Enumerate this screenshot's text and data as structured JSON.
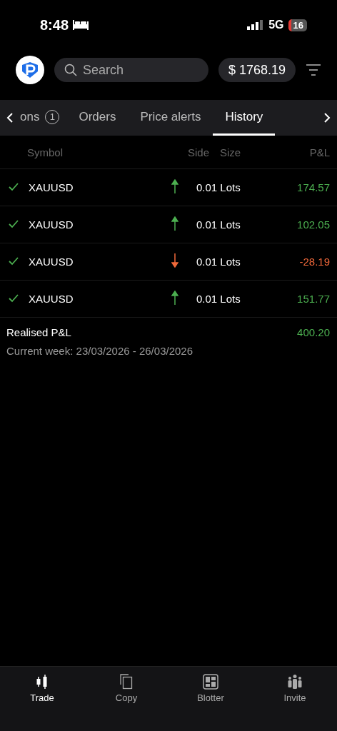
{
  "status_bar": {
    "time": "8:48",
    "network": "5G",
    "battery": "16"
  },
  "header": {
    "search": {
      "placeholder": "Search"
    },
    "balance": "$ 1768.19"
  },
  "tabs": [
    {
      "label": "ons",
      "count": "1",
      "selected": false
    },
    {
      "label": "Orders",
      "selected": false
    },
    {
      "label": "Price alerts",
      "selected": false
    },
    {
      "label": "History",
      "selected": true
    }
  ],
  "table": {
    "columns": [
      "Symbol",
      "Side",
      "Size",
      "P&L"
    ],
    "rows": [
      {
        "checked": true,
        "symbol": "XAUUSD",
        "kind": "buy",
        "size": "0.01 Lots",
        "pnl": "174.57",
        "color": "#4caf50"
      },
      {
        "checked": true,
        "symbol": "XAUUSD",
        "kind": "buy",
        "size": "0.01 Lots",
        "pnl": "102.05",
        "color": "#4caf50"
      },
      {
        "checked": true,
        "symbol": "XAUUSD",
        "kind": "sell",
        "size": "0.01 Lots",
        "pnl": "-28.19",
        "color": "#f0683a"
      },
      {
        "checked": true,
        "symbol": "XAUUSD",
        "kind": "buy",
        "size": "0.01 Lots",
        "pnl": "151.77",
        "color": "#4caf50"
      }
    ]
  },
  "summary": {
    "label": "Realised P&L",
    "value": "400.20",
    "color": "#4caf50",
    "period": "Current week: 23/03/2026 - 26/03/2026"
  },
  "bottom_nav": [
    {
      "label": "Trade",
      "selected": true
    },
    {
      "label": "Copy",
      "selected": false
    },
    {
      "label": "Blotter",
      "selected": false
    },
    {
      "label": "Invite",
      "selected": false
    }
  ]
}
